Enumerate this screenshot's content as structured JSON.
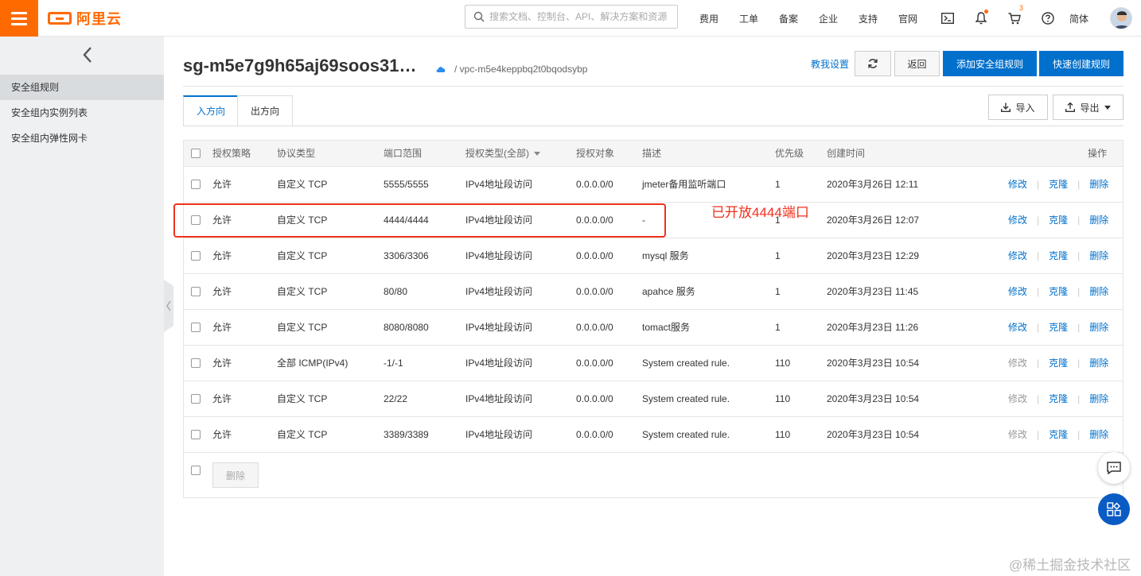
{
  "brand": {
    "logo_text": "阿里云",
    "color": "#ff6a00"
  },
  "search": {
    "placeholder": "搜索文档、控制台、API、解决方案和资源"
  },
  "topnav": [
    "费用",
    "工单",
    "备案",
    "企业",
    "支持",
    "官网"
  ],
  "top_icons": [
    "terminal-icon",
    "bell-icon",
    "cart-icon",
    "help-icon"
  ],
  "cart_badge": "3",
  "lang": "简体",
  "sidebar": {
    "items": [
      {
        "label": "安全组规则",
        "active": true
      },
      {
        "label": "安全组内实例列表",
        "active": false
      },
      {
        "label": "安全组内弹性网卡",
        "active": false
      }
    ]
  },
  "header": {
    "title": "sg-m5e7g9h65aj69soos31…",
    "vpc": "/ vpc-m5e4keppbq2t0bqodsybp",
    "teach_link": "教我设置",
    "back_label": "返回",
    "add_rule_label": "添加安全组规则",
    "quick_rule_label": "快速创建规则",
    "accent": "#0070cc"
  },
  "tabs": [
    {
      "label": "入方向",
      "active": true
    },
    {
      "label": "出方向",
      "active": false
    }
  ],
  "toolbar": {
    "import_label": "导入",
    "export_label": "导出"
  },
  "table": {
    "columns": [
      "授权策略",
      "协议类型",
      "端口范围",
      "授权类型(全部)",
      "授权对象",
      "描述",
      "优先级",
      "创建时间",
      "操作"
    ],
    "rows": [
      {
        "policy": "允许",
        "protocol": "自定义 TCP",
        "port": "5555/5555",
        "auth_type": "IPv4地址段访问",
        "target": "0.0.0.0/0",
        "desc": "jmeter备用监听端口",
        "priority": "1",
        "created": "2020年3月26日 12:11",
        "edit_enabled": true
      },
      {
        "policy": "允许",
        "protocol": "自定义 TCP",
        "port": "4444/4444",
        "auth_type": "IPv4地址段访问",
        "target": "0.0.0.0/0",
        "desc": "-",
        "priority": "1",
        "created": "2020年3月26日 12:07",
        "edit_enabled": true
      },
      {
        "policy": "允许",
        "protocol": "自定义 TCP",
        "port": "3306/3306",
        "auth_type": "IPv4地址段访问",
        "target": "0.0.0.0/0",
        "desc": "mysql 服务",
        "priority": "1",
        "created": "2020年3月23日 12:29",
        "edit_enabled": true
      },
      {
        "policy": "允许",
        "protocol": "自定义 TCP",
        "port": "80/80",
        "auth_type": "IPv4地址段访问",
        "target": "0.0.0.0/0",
        "desc": "apahce 服务",
        "priority": "1",
        "created": "2020年3月23日 11:45",
        "edit_enabled": true
      },
      {
        "policy": "允许",
        "protocol": "自定义 TCP",
        "port": "8080/8080",
        "auth_type": "IPv4地址段访问",
        "target": "0.0.0.0/0",
        "desc": "tomact服务",
        "priority": "1",
        "created": "2020年3月23日 11:26",
        "edit_enabled": true
      },
      {
        "policy": "允许",
        "protocol": "全部 ICMP(IPv4)",
        "port": "-1/-1",
        "auth_type": "IPv4地址段访问",
        "target": "0.0.0.0/0",
        "desc": "System created rule.",
        "priority": "110",
        "created": "2020年3月23日 10:54",
        "edit_enabled": false
      },
      {
        "policy": "允许",
        "protocol": "自定义 TCP",
        "port": "22/22",
        "auth_type": "IPv4地址段访问",
        "target": "0.0.0.0/0",
        "desc": "System created rule.",
        "priority": "110",
        "created": "2020年3月23日 10:54",
        "edit_enabled": false
      },
      {
        "policy": "允许",
        "protocol": "自定义 TCP",
        "port": "3389/3389",
        "auth_type": "IPv4地址段访问",
        "target": "0.0.0.0/0",
        "desc": "System created rule.",
        "priority": "110",
        "created": "2020年3月23日 10:54",
        "edit_enabled": false
      }
    ],
    "actions": {
      "edit": "修改",
      "clone": "克隆",
      "delete": "删除"
    },
    "footer_delete": "删除"
  },
  "annotation": {
    "text": "已开放4444端口",
    "color": "#f0301c"
  },
  "floating": [
    "chat-icon",
    "apps-icon"
  ],
  "watermark": "@稀土掘金技术社区"
}
